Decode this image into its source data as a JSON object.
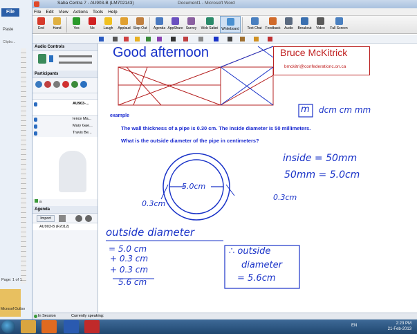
{
  "word": {
    "file_tab": "File",
    "paste": "Paste",
    "clipboard": "Clipbo...",
    "page_status": "Page: 1 of 1",
    "outlook_label": "Microsof Outloo"
  },
  "window": {
    "title": "Saba Centra 7 - AU903-B (LM702143)",
    "title_behind": "Document1 - Microsoft Word"
  },
  "menu": [
    "File",
    "Edit",
    "View",
    "Actions",
    "Tools",
    "Help"
  ],
  "toolbar": [
    {
      "label": "End",
      "icon": "end-icon",
      "color": "#d63a2a"
    },
    {
      "label": "Hand",
      "icon": "hand-icon",
      "color": "#e0b040"
    },
    {
      "label": "Yes",
      "icon": "check-icon",
      "color": "#2a9a2a"
    },
    {
      "label": "No",
      "icon": "x-icon",
      "color": "#d02020"
    },
    {
      "label": "Laugh",
      "icon": "laugh-icon",
      "color": "#f0c020"
    },
    {
      "label": "Applaud",
      "icon": "applaud-icon",
      "color": "#e0a030"
    },
    {
      "label": "Step Out",
      "icon": "stepout-icon",
      "color": "#c08040"
    },
    {
      "label": "Agenda",
      "icon": "agenda-icon",
      "color": "#4a7ac0"
    },
    {
      "label": "AppShare",
      "icon": "appshare-icon",
      "color": "#6a50c0"
    },
    {
      "label": "Survey",
      "icon": "survey-icon",
      "color": "#8a60a0"
    },
    {
      "label": "Web Safari",
      "icon": "globe-icon",
      "color": "#2a8a6a"
    },
    {
      "label": "Whiteboard",
      "icon": "whiteboard-icon",
      "color": "#4a90d0"
    },
    {
      "label": "Text Chat",
      "icon": "chat-icon",
      "color": "#4a80c0"
    },
    {
      "label": "Feedback",
      "icon": "feedback-icon",
      "color": "#d06a2a"
    },
    {
      "label": "Audio",
      "icon": "audio-icon",
      "color": "#5a6a80"
    },
    {
      "label": "Breakout",
      "icon": "breakout-icon",
      "color": "#3a70b0"
    },
    {
      "label": "Video",
      "icon": "video-icon",
      "color": "#5a5a5a"
    },
    {
      "label": "Full Screen",
      "icon": "fullscreen-icon",
      "color": "#4a80c0"
    }
  ],
  "left": {
    "audio_title": "Audio Controls",
    "participants_title": "Participants",
    "host_name": "AU903-...",
    "participants": [
      "Ience Ma...",
      "Mary Gae...",
      "Travis Be..."
    ],
    "small_label": "a",
    "agenda_title": "Agenda",
    "import_label": "Import",
    "agenda_item": "AU903-B (F2012)"
  },
  "whiteboard": {
    "greeting": "Good afternoon",
    "name": "Bruce McKitrick",
    "email": "bmckitri@confederationc.on.ca",
    "example": "example",
    "question1": "The wall thickness of a pipe is 0.30 cm.  The inside diameter is 50 millimeters.",
    "question2": "What is the outside diameter of the pipe in centimeters?",
    "units": "dcm  cm    mm",
    "unit_boxed": "m",
    "inside1": "inside = 50mm",
    "inside2": "50mm =  5.0cm",
    "diam_label": "5.0cm",
    "left_thick": "0.3cm",
    "right_thick": "0.3cm",
    "od_title": "outside  diameter",
    "calc1": "= 5.0 cm",
    "calc2": "+ 0.3 cm",
    "calc3": "+ 0.3 cm",
    "calc4": "5.6 cm",
    "ans1": "∴ outside",
    "ans2": "diameter",
    "ans3": "= 5.6cm"
  },
  "status": {
    "session": "In Session",
    "speaking": "Currently speaking:"
  },
  "tray": {
    "lang": "EN",
    "time": "2:23 PM",
    "date": "21-Feb-2013"
  }
}
